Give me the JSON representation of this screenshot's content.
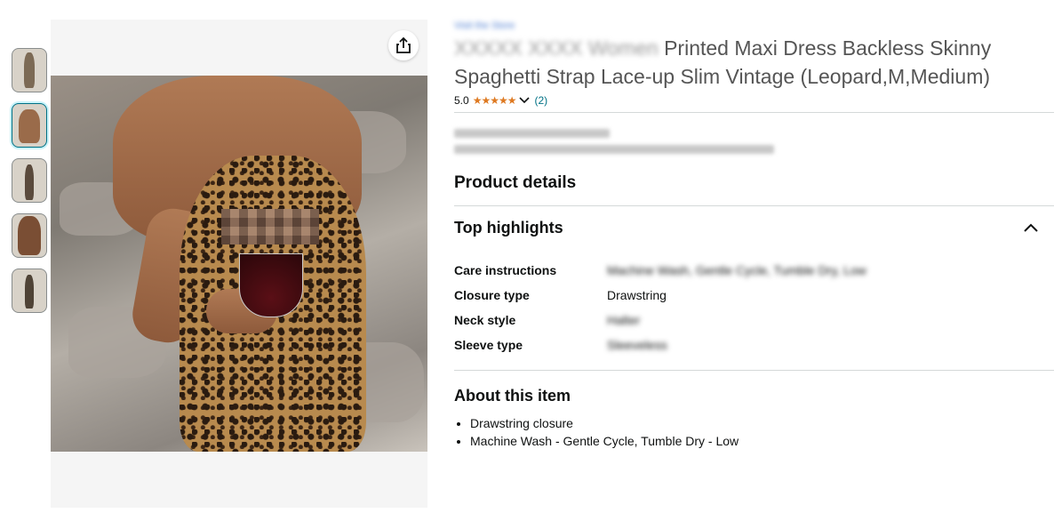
{
  "thumbnails": [
    {
      "label": "thumbnail-1"
    },
    {
      "label": "thumbnail-2"
    },
    {
      "label": "thumbnail-3"
    },
    {
      "label": "thumbnail-4"
    },
    {
      "label": "thumbnail-5"
    }
  ],
  "product": {
    "store_link": "Visit the Store",
    "title_blurred_prefix": "XXXXX XXXX Women",
    "title": "Printed Maxi Dress Backless Skinny Spaghetti Strap Lace-up Slim Vintage (Leopard,M,Medium)",
    "rating_value": "5.0",
    "stars": "★★★★★",
    "rating_count": "(2)"
  },
  "product_details": {
    "heading": "Product details",
    "top_highlights": "Top highlights",
    "specs": [
      {
        "label": "Care instructions",
        "value": "Machine Wash, Gentle Cycle, Tumble Dry, Low",
        "blurred": true
      },
      {
        "label": "Closure type",
        "value": "Drawstring",
        "blurred": false
      },
      {
        "label": "Neck style",
        "value": "Halter",
        "blurred": true
      },
      {
        "label": "Sleeve type",
        "value": "Sleeveless",
        "blurred": true
      }
    ]
  },
  "about": {
    "heading": "About this item",
    "bullets": [
      "Drawstring closure",
      "Machine Wash - Gentle Cycle, Tumble Dry - Low"
    ]
  },
  "colors": {
    "link": "#007185",
    "star": "#de7921",
    "divider": "#d5d9d9"
  }
}
